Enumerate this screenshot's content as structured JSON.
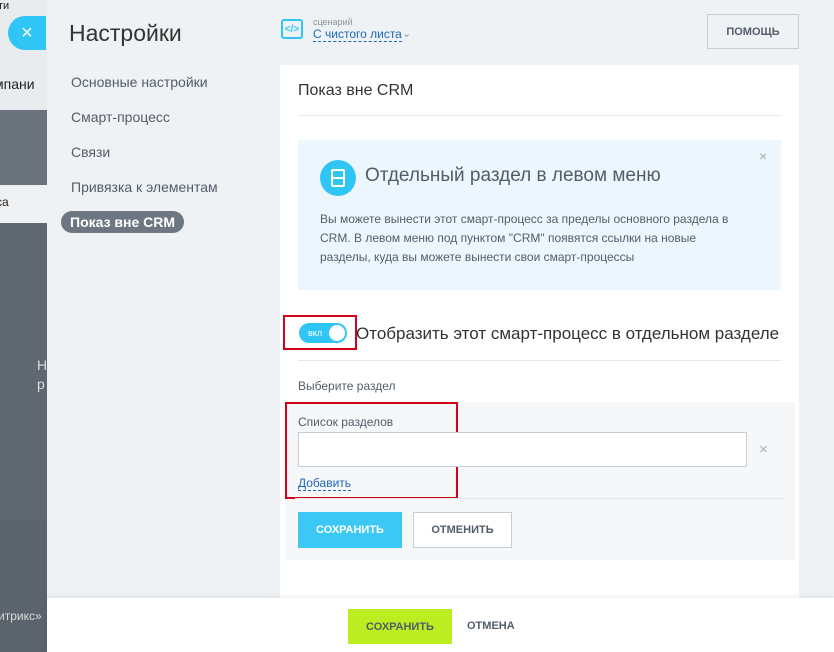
{
  "background": {
    "top_text": "ти",
    "company_text": "мпани",
    "list_text": "са",
    "gray_text1": "Н",
    "gray_text2": "р",
    "footer_text": "итрикс»"
  },
  "slider": {
    "close_symbol": "×",
    "title": "Настройки",
    "menu": [
      {
        "label": "Основные настройки"
      },
      {
        "label": "Смарт-процесс"
      },
      {
        "label": "Связи"
      },
      {
        "label": "Привязка к элементам"
      },
      {
        "label": "Показ вне CRM"
      }
    ]
  },
  "topbar": {
    "scenario_icon": "</>",
    "scenario_caption": "сценарий",
    "scenario_value": "С чистого листа",
    "scenario_chevron": "⌄",
    "help_label": "ПОМОЩЬ"
  },
  "panel": {
    "title": "Показ вне CRM",
    "info": {
      "title": "Отдельный раздел в левом меню",
      "close": "×",
      "text": "Вы можете вынести этот смарт-процесс за пределы основного раздела в CRM. В левом меню под пунктом \"CRM\" появятся ссылки на новые разделы, куда вы можете вынести свои смарт-процессы"
    },
    "toggle_label": "вкл",
    "show_label": "Отобразить этот смарт-процесс в отдельном разделе",
    "pick_label": "Выберите раздел",
    "list_label": "Список разделов",
    "list_value": "",
    "list_remove": "×",
    "add_link": "Добавить",
    "save_label": "СОХРАНИТЬ",
    "cancel_label": "ОТМЕНИТЬ"
  },
  "footer": {
    "save_label": "СОХРАНИТЬ",
    "cancel_label": "ОТМЕНА"
  },
  "colors": {
    "accent": "#2fc6f6",
    "save_green": "#bbed21",
    "highlight_red": "#d0021b"
  }
}
